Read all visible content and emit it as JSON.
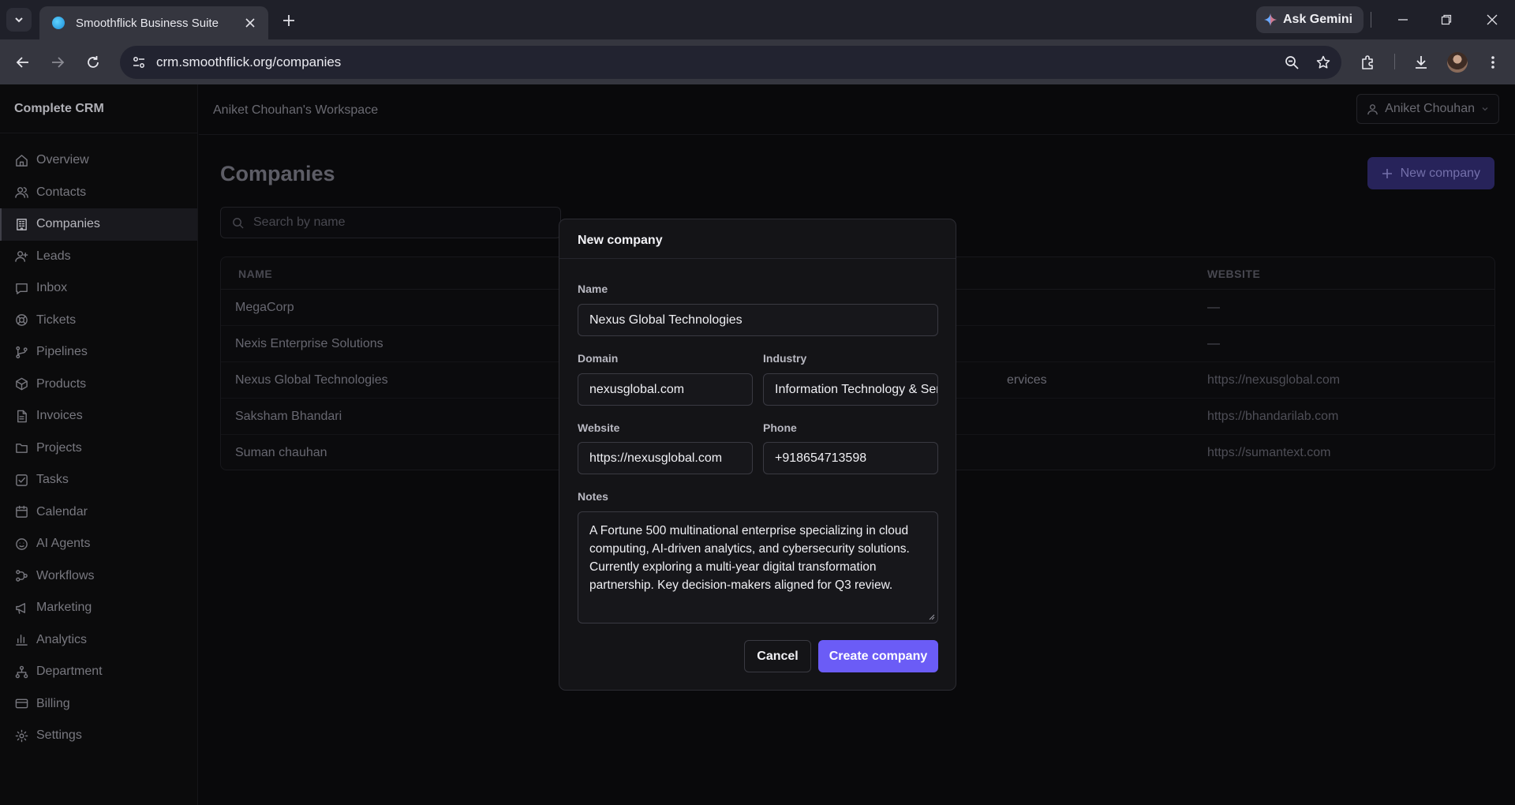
{
  "browser": {
    "tab_title": "Smoothflick Business Suite",
    "url": "crm.smoothflick.org/companies",
    "ask_gemini": "Ask Gemini"
  },
  "app": {
    "brand": "Complete CRM",
    "workspace": "Aniket Chouhan's Workspace",
    "user_name": "Aniket Chouhan",
    "nav": [
      {
        "label": "Overview",
        "icon": "home-icon"
      },
      {
        "label": "Contacts",
        "icon": "users-icon"
      },
      {
        "label": "Companies",
        "icon": "building-icon",
        "active": true
      },
      {
        "label": "Leads",
        "icon": "user-plus-icon"
      },
      {
        "label": "Inbox",
        "icon": "message-icon"
      },
      {
        "label": "Tickets",
        "icon": "lifebuoy-icon"
      },
      {
        "label": "Pipelines",
        "icon": "git-branch-icon"
      },
      {
        "label": "Products",
        "icon": "package-icon"
      },
      {
        "label": "Invoices",
        "icon": "file-icon"
      },
      {
        "label": "Projects",
        "icon": "folder-icon"
      },
      {
        "label": "Tasks",
        "icon": "check-square-icon"
      },
      {
        "label": "Calendar",
        "icon": "calendar-icon"
      },
      {
        "label": "AI Agents",
        "icon": "bot-icon"
      },
      {
        "label": "Workflows",
        "icon": "workflow-icon"
      },
      {
        "label": "Marketing",
        "icon": "megaphone-icon"
      },
      {
        "label": "Analytics",
        "icon": "bar-chart-icon"
      },
      {
        "label": "Department",
        "icon": "network-icon"
      },
      {
        "label": "Billing",
        "icon": "credit-card-icon"
      },
      {
        "label": "Settings",
        "icon": "gear-icon"
      }
    ]
  },
  "companies_page": {
    "title": "Companies",
    "new_company_label": "New company",
    "search_placeholder": "Search by name",
    "columns": {
      "name": "NAME",
      "website": "WEBSITE"
    },
    "rows": [
      {
        "name": "MegaCorp",
        "industry": "",
        "website": "—"
      },
      {
        "name": "Nexis Enterprise Solutions",
        "industry": "",
        "website": "—"
      },
      {
        "name": "Nexus Global Technologies",
        "industry": "ervices",
        "website": "https://nexusglobal.com"
      },
      {
        "name": "Saksham Bhandari",
        "industry": "",
        "website": "https://bhandarilab.com"
      },
      {
        "name": "Suman chauhan",
        "industry": "",
        "website": "https://sumantext.com"
      }
    ]
  },
  "modal": {
    "title": "New company",
    "name_label": "Name",
    "name_value": "Nexus Global Technologies",
    "domain_label": "Domain",
    "domain_value": "nexusglobal.com",
    "industry_label": "Industry",
    "industry_value": "Information Technology & Services",
    "website_label": "Website",
    "website_value": "https://nexusglobal.com",
    "phone_label": "Phone",
    "phone_value": "+918654713598",
    "notes_label": "Notes",
    "notes_value": "A Fortune 500 multinational enterprise specializing in cloud computing, AI-driven analytics, and cybersecurity solutions. Currently exploring a multi-year digital transformation partnership. Key decision-makers aligned for Q3 review.",
    "cancel_label": "Cancel",
    "create_label": "Create company"
  },
  "colors": {
    "accent": "#6b5cf6",
    "accent_dim": "#2e2a6a",
    "background": "#0b0b0d",
    "chrome": "#35363f"
  }
}
